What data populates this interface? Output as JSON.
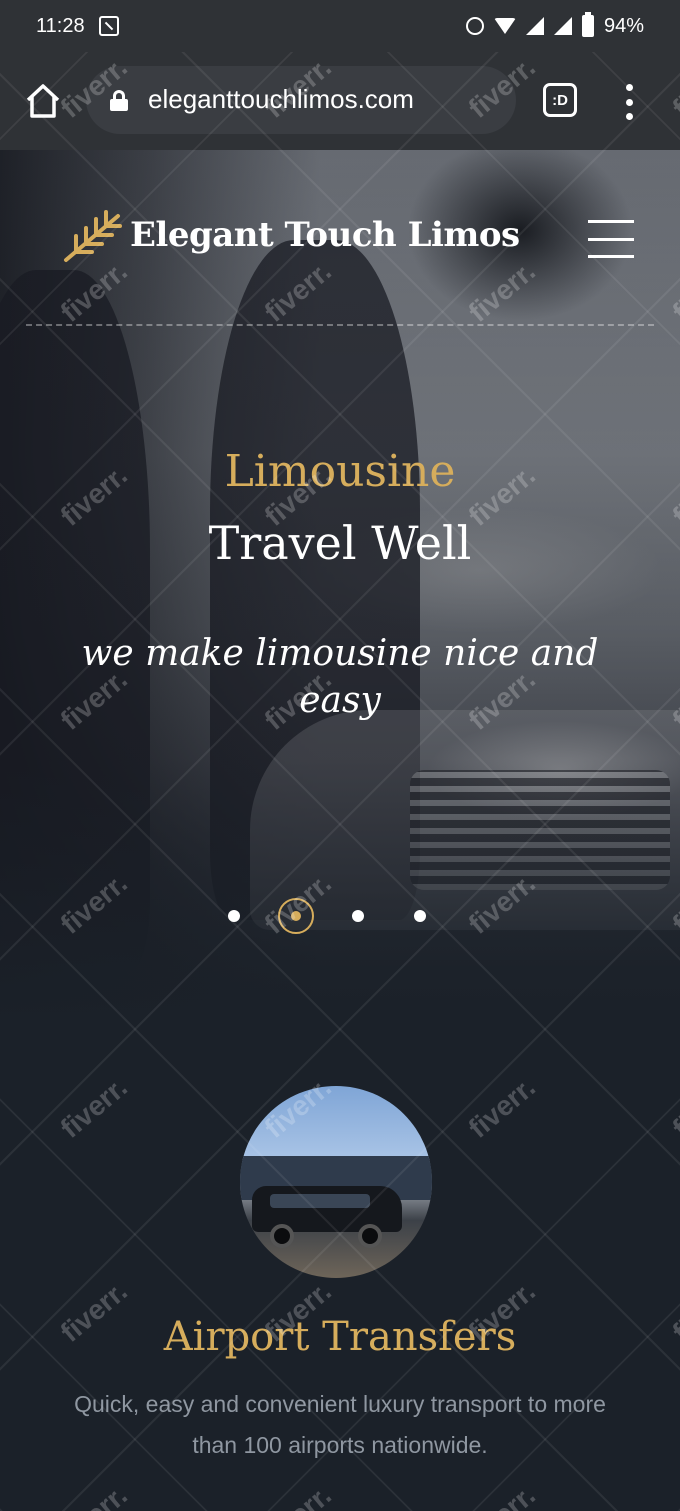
{
  "status_bar": {
    "time": "11:28",
    "battery": "94%",
    "icons": [
      "screenshot-icon",
      "alarm-icon",
      "wifi-icon",
      "signal-icon",
      "signal-icon",
      "battery-icon"
    ]
  },
  "browser": {
    "url": "eleganttouchlimos.com",
    "tab_switcher_label": ":D",
    "icons": [
      "home-icon",
      "lock-icon",
      "tab-switcher-icon",
      "more-options-icon"
    ]
  },
  "site": {
    "brand_name": "Elegant Touch Limos",
    "logo_icon": "wheat-logo-icon",
    "menu_icon": "hamburger-menu-icon"
  },
  "hero": {
    "kicker": "Limousine",
    "title": "Travel Well",
    "subtitle": "we make limousine nice and easy",
    "slides_total": 4,
    "active_slide": 2
  },
  "service": {
    "title": "Airport Transfers",
    "description": "Quick, easy and convenient luxury transport to more than 100 airports nationwide."
  },
  "watermark": {
    "text": "fiverr."
  },
  "colors": {
    "accent_gold": "#d6ad5c",
    "page_background": "#1b2129",
    "browser_chrome": "#2f3236",
    "muted_text": "#8f97a1"
  }
}
